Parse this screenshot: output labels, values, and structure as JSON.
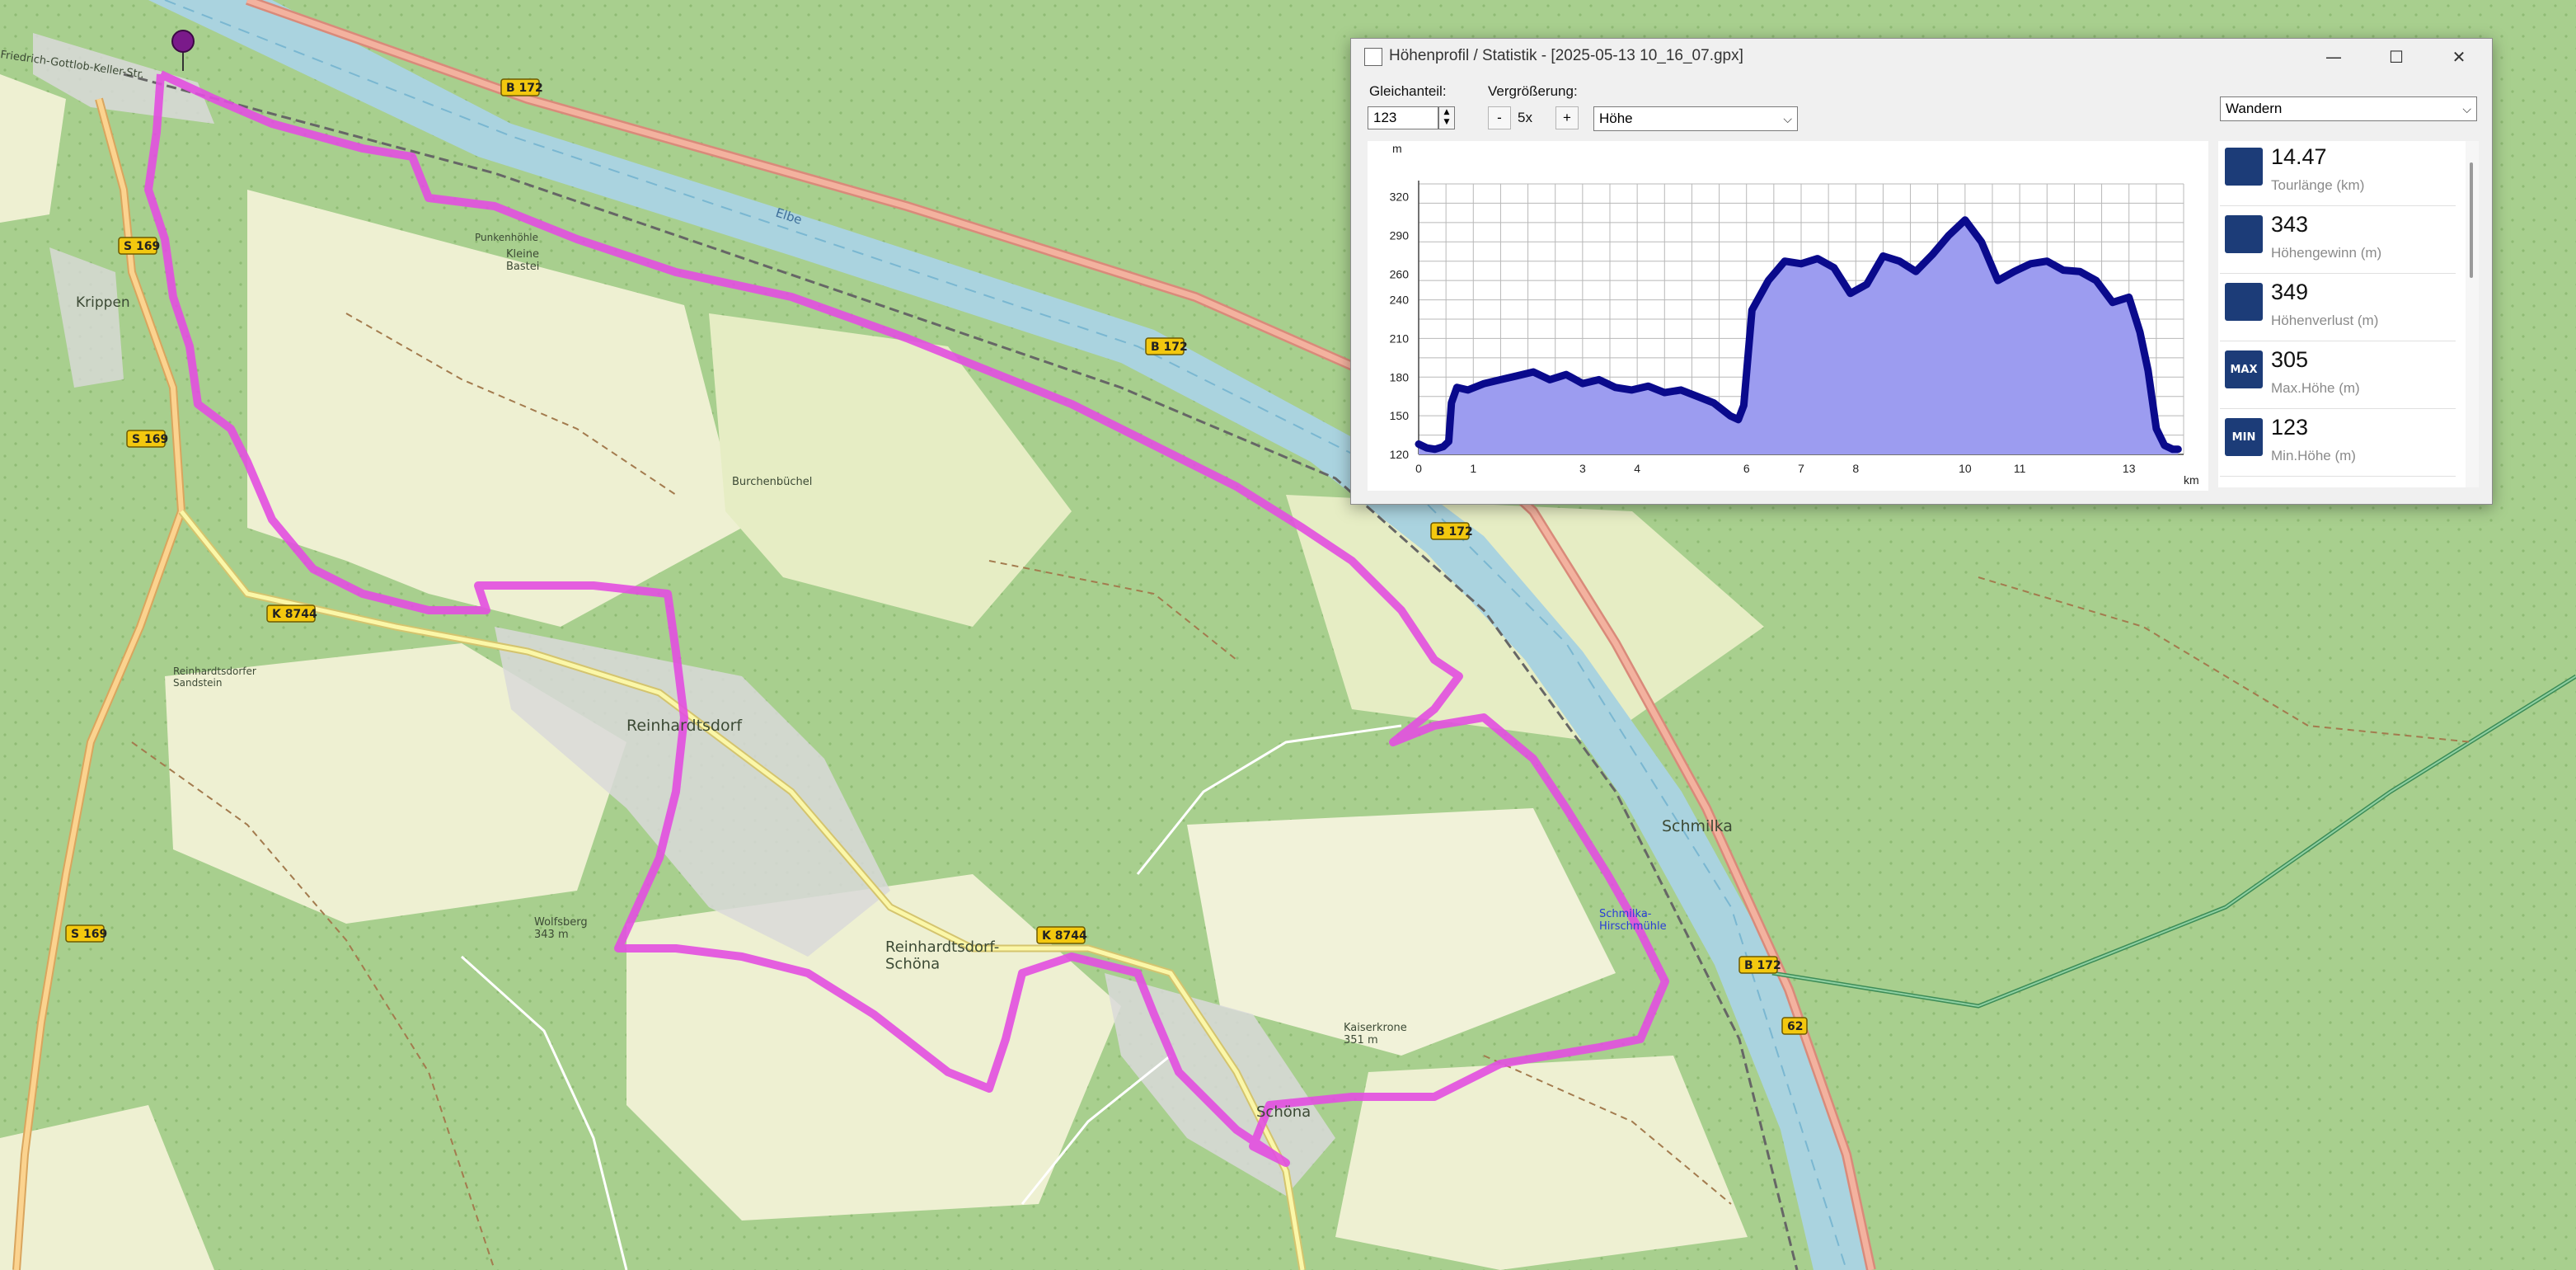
{
  "map": {
    "labels": {
      "krippen": "Krippen",
      "reinhardtsdorf": "Reinhardtsdorf",
      "reinhardtsdorf_schona": "Reinhardtsdorf-\nSchöna",
      "schona": "Schöna",
      "schmilka": "Schmilka",
      "schmilka_hirschmuehle": "Schmilka-\nHirschmühle",
      "elbe": "Elbe",
      "wolfsberg": "Wolfsberg\n343 m",
      "kaiserkrone": "Kaiserkrone\n351 m",
      "burchenbuchel": "Burchenbüchel",
      "kleine_bastei": "Kleine\nBastei",
      "reinhardtsdorfer_sandstein": "Reinhardtsdorfer\nSandstein",
      "puntkenhohle": "Punkenhöhle",
      "friedrich_gottlob_keller_str": "Friedrich-Gottlob-Keller-Str."
    },
    "road_badges": [
      "B 172",
      "B 172",
      "B 172",
      "B 172",
      "S 169",
      "S 169",
      "S 169",
      "K 8744",
      "K 8744",
      "62"
    ]
  },
  "window": {
    "title": "Höhenprofil / Statistik - [2025-05-13 10_16_07.gpx]",
    "controls": {
      "minimize": "—",
      "maximize": "☐",
      "close": "✕"
    }
  },
  "toolbar": {
    "smooth_label": "Gleichanteil:",
    "smooth_value": "123",
    "zoom_label": "Vergrößerung:",
    "zoom_minus": "-",
    "zoom_value": "5x",
    "zoom_plus": "+",
    "profile_select": "Höhe",
    "activity_select": "Wandern"
  },
  "stats": [
    {
      "icon": "route-icon",
      "value": "14.47",
      "caption": "Tourlänge (km)"
    },
    {
      "icon": "elevation-gain-icon",
      "value": "343",
      "caption": "Höhengewinn (m)"
    },
    {
      "icon": "elevation-loss-icon",
      "value": "349",
      "caption": "Höhenverlust (m)"
    },
    {
      "icon": "max-height-icon",
      "value": "305",
      "caption": "Max.Höhe (m)"
    },
    {
      "icon": "min-height-icon",
      "value": "123",
      "caption": "Min.Höhe (m)"
    }
  ],
  "stat_icon_text": [
    "",
    "",
    "",
    "MAX",
    "MIN"
  ],
  "chart_data": {
    "type": "area",
    "ylabel": "m",
    "xlabel": "km",
    "xlim": [
      0,
      14
    ],
    "ylim": [
      120,
      330
    ],
    "xticks": [
      0,
      1,
      3,
      4,
      6,
      7,
      8,
      10,
      11,
      13
    ],
    "yticks": [
      120,
      150,
      180,
      210,
      240,
      260,
      290,
      320
    ],
    "fill_color": "#9c9cf0",
    "line_color": "#0a0a8c",
    "x": [
      0.0,
      0.15,
      0.3,
      0.45,
      0.55,
      0.6,
      0.7,
      0.9,
      1.2,
      1.5,
      1.8,
      2.1,
      2.4,
      2.7,
      3.0,
      3.3,
      3.6,
      3.9,
      4.2,
      4.5,
      4.8,
      5.1,
      5.4,
      5.7,
      5.85,
      5.95,
      6.1,
      6.4,
      6.7,
      7.0,
      7.3,
      7.6,
      7.9,
      8.2,
      8.5,
      8.8,
      9.1,
      9.4,
      9.7,
      10.0,
      10.3,
      10.6,
      10.9,
      11.2,
      11.5,
      11.8,
      12.1,
      12.4,
      12.7,
      13.0,
      13.2,
      13.35,
      13.5,
      13.65,
      13.8,
      13.9
    ],
    "y": [
      128,
      125,
      124,
      126,
      130,
      160,
      172,
      170,
      175,
      178,
      181,
      184,
      178,
      182,
      175,
      178,
      172,
      170,
      173,
      168,
      170,
      165,
      160,
      150,
      147,
      158,
      232,
      255,
      270,
      268,
      272,
      265,
      245,
      252,
      274,
      270,
      262,
      275,
      290,
      302,
      285,
      255,
      262,
      268,
      270,
      263,
      262,
      255,
      238,
      242,
      215,
      185,
      140,
      127,
      124,
      124
    ]
  }
}
